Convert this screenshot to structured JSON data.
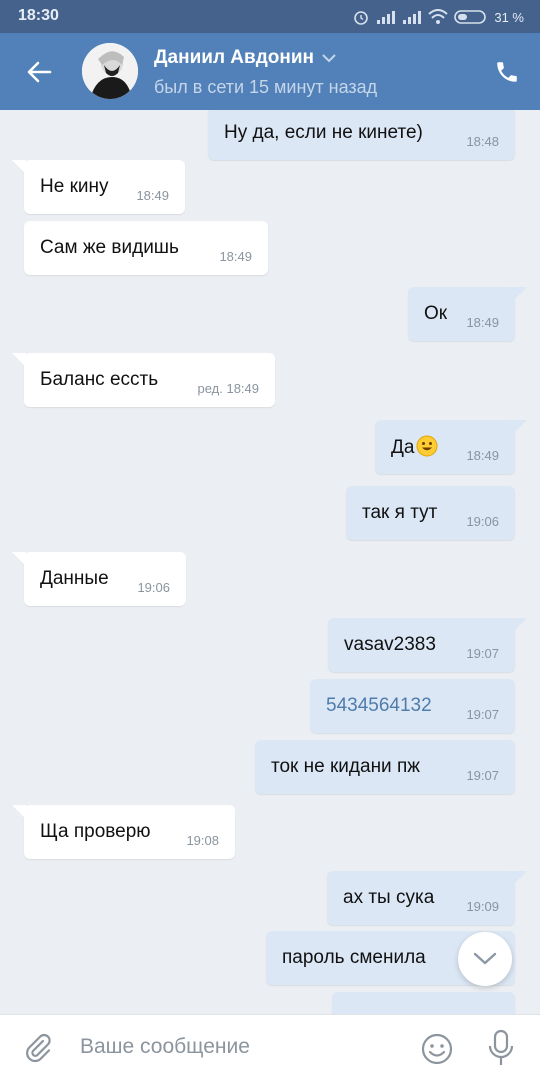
{
  "status_bar": {
    "time": "18:30",
    "battery": "31 %"
  },
  "header": {
    "contact_name": "Даниил Авдонин",
    "last_seen": "был в сети 15 минут назад"
  },
  "messages": [
    {
      "dir": "out",
      "text": "Ну да, если не кинете)",
      "time": "18:48"
    },
    {
      "dir": "in",
      "text": "Не кину",
      "time": "18:49"
    },
    {
      "dir": "in",
      "text": "Сам же видишь",
      "time": "18:49"
    },
    {
      "dir": "out",
      "text": "Ок",
      "time": "18:49"
    },
    {
      "dir": "in",
      "text": "Баланс ессть",
      "time": "ред. 18:49"
    },
    {
      "dir": "out",
      "text": "Да",
      "time": "18:49",
      "emoji": "smiley-emoji"
    },
    {
      "dir": "out",
      "text": "так я тут",
      "time": "19:06"
    },
    {
      "dir": "in",
      "text": "Данные",
      "time": "19:06"
    },
    {
      "dir": "out",
      "text": "vasav2383",
      "time": "19:07"
    },
    {
      "dir": "out",
      "text": "5434564132",
      "time": "19:07",
      "is_link": true
    },
    {
      "dir": "out",
      "text": "ток не кидани пж",
      "time": "19:07"
    },
    {
      "dir": "in",
      "text": "Ща проверю",
      "time": "19:08"
    },
    {
      "dir": "out",
      "text": "ах ты сука",
      "time": "19:09"
    },
    {
      "dir": "out",
      "text": "пароль сменила",
      "time": ""
    },
    {
      "dir": "out",
      "text": "",
      "time": ""
    }
  ],
  "composer": {
    "placeholder": "Ваше сообщение"
  },
  "colors": {
    "header": "#5181b8",
    "status_bar": "#44628b",
    "chat_bg": "#ebeff3",
    "incoming_bubble": "#ffffff",
    "outgoing_bubble": "#dbe7f5",
    "link": "#4f7cab"
  },
  "icons": [
    "back-arrow-icon",
    "phone-icon",
    "chevron-down-icon",
    "paperclip-icon",
    "emoji-icon",
    "microphone-icon",
    "scroll-down-icon",
    "smiley-emoji"
  ]
}
